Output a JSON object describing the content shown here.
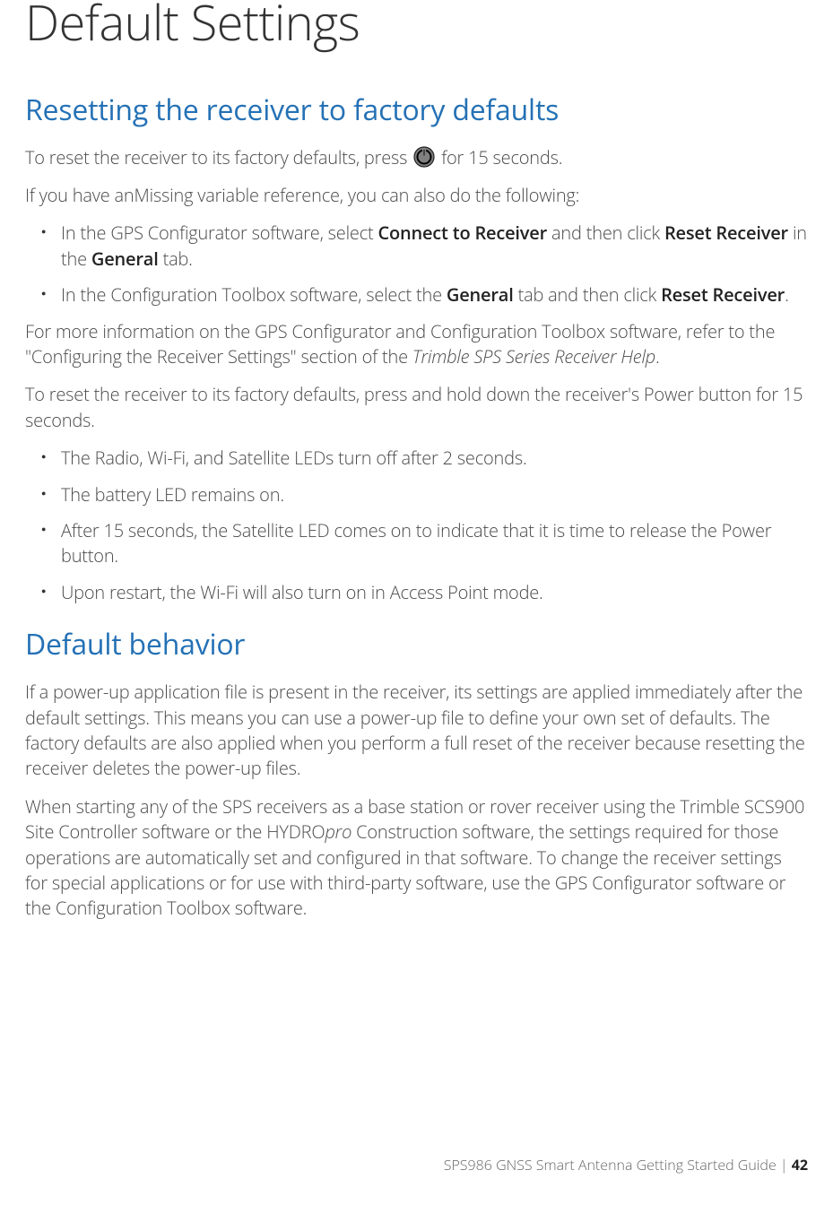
{
  "title": "Default Settings",
  "section1": {
    "heading": "Resetting the receiver to factory defaults",
    "p1_a": "To reset the receiver to its factory defaults, press ",
    "p1_b": " for 15 seconds.",
    "p2": "If you have anMissing variable reference, you can also do the following:",
    "list1": {
      "i1_a": "In the GPS Configurator software, select ",
      "i1_b": "Connect to Receiver",
      "i1_c": " and then click ",
      "i1_d": "Reset Receiver",
      "i1_e": " in the ",
      "i1_f": "General",
      "i1_g": " tab.",
      "i2_a": "In the Configuration Toolbox software, select the ",
      "i2_b": "General",
      "i2_c": " tab and then click ",
      "i2_d": "Reset Receiver",
      "i2_e": "."
    },
    "p3_a": "For more information on the GPS Configurator and Configuration Toolbox software, refer to the \"Configuring the Receiver Settings\" section of the ",
    "p3_b": "Trimble SPS Series Receiver Help",
    "p3_c": ".",
    "p4": "To reset the receiver to its factory defaults, press and hold down the receiver's Power button for 15 seconds.",
    "list2": {
      "i1": "The Radio, Wi-Fi, and Satellite LEDs turn off after 2 seconds.",
      "i2": "The battery LED remains on.",
      "i3": "After 15 seconds, the Satellite LED comes on to indicate that it is time to release the Power button.",
      "i4": "Upon restart, the Wi-Fi will also turn on in Access Point mode."
    }
  },
  "section2": {
    "heading": "Default behavior",
    "p1": "If a power-up application file is present in the receiver, its settings are applied immediately after the default settings. This means you can use a power-up file to define your own set of defaults. The factory defaults are also applied when you perform a full reset of the receiver because resetting the receiver deletes the power-up files.",
    "p2_a": "When starting any of the SPS receivers as a base station or rover receiver using the Trimble SCS900 Site Controller software or the HYDRO",
    "p2_b": "pro",
    "p2_c": " Construction software, the settings required for those operations are automatically set and configured in that software. To change the receiver settings for special applications or for use with third-party software, use the GPS Configurator software or the Configuration Toolbox software."
  },
  "footer": {
    "guide": "SPS986 GNSS Smart Antenna Getting Started Guide ",
    "sep": " | ",
    "page": "42"
  }
}
